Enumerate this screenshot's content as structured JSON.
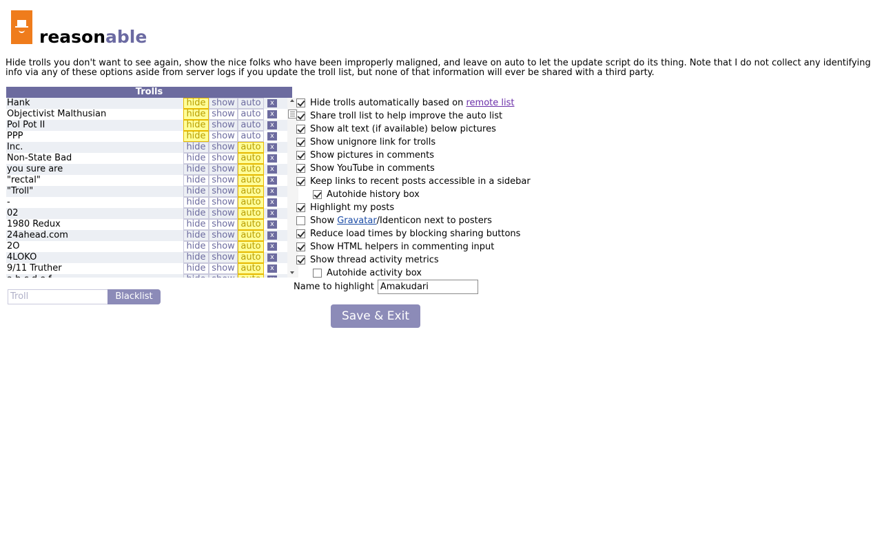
{
  "brand": {
    "text_a": "reason",
    "text_b": "able"
  },
  "intro": "Hide trolls you don't want to see again, show the nice folks who have been improperly maligned, and leave on auto to let the update script do its thing. Note that I do not collect any identifying info via any of these options aside from server logs if you update the troll list, but none of that information will ever be shared with a third party.",
  "trolls": {
    "header": "Trolls",
    "button_labels": {
      "hide": "hide",
      "show": "show",
      "auto": "auto",
      "remove": "x"
    },
    "rows": [
      {
        "name": "Hank",
        "state": "hide"
      },
      {
        "name": "Objectivist Malthusian",
        "state": "hide"
      },
      {
        "name": "Pol Pot II",
        "state": "hide"
      },
      {
        "name": "PPP",
        "state": "hide"
      },
      {
        "name": "Inc.",
        "state": "auto"
      },
      {
        "name": "Non-State Bad",
        "state": "auto"
      },
      {
        "name": "you sure are",
        "state": "auto"
      },
      {
        "name": "\"rectal\"",
        "state": "auto"
      },
      {
        "name": "\"Troll\"",
        "state": "auto"
      },
      {
        "name": "-",
        "state": "auto"
      },
      {
        "name": "02",
        "state": "auto"
      },
      {
        "name": "1980 Redux",
        "state": "auto"
      },
      {
        "name": "24ahead.com",
        "state": "auto"
      },
      {
        "name": "2O",
        "state": "auto"
      },
      {
        "name": "4LOKO",
        "state": "auto"
      },
      {
        "name": "9/11 Truther",
        "state": "auto"
      },
      {
        "name": "a b c d e f",
        "state": "auto"
      }
    ]
  },
  "blacklist": {
    "placeholder": "Troll",
    "button": "Blacklist"
  },
  "options": [
    {
      "label": "Hide trolls automatically based on ",
      "link": "remote list",
      "link_class": "purple",
      "checked": true,
      "sub": false
    },
    {
      "label": "Share troll list to help improve the auto list",
      "checked": true,
      "sub": false
    },
    {
      "label": "Show alt text (if available) below pictures",
      "checked": true,
      "sub": false
    },
    {
      "label": "Show unignore link for trolls",
      "checked": true,
      "sub": false
    },
    {
      "label": "Show pictures in comments",
      "checked": true,
      "sub": false
    },
    {
      "label": "Show YouTube in comments",
      "checked": true,
      "sub": false
    },
    {
      "label": "Keep links to recent posts accessible in a sidebar",
      "checked": true,
      "sub": false
    },
    {
      "label": "Autohide history box",
      "checked": true,
      "sub": true
    },
    {
      "label": "Highlight my posts",
      "checked": true,
      "sub": false
    },
    {
      "label": "Show ",
      "link": "Gravatar",
      "link_class": "blue",
      "suffix": "/Identicon next to posters",
      "checked": false,
      "sub": false
    },
    {
      "label": "Reduce load times by blocking sharing buttons",
      "checked": true,
      "sub": false
    },
    {
      "label": "Show HTML helpers in commenting input",
      "checked": true,
      "sub": false
    },
    {
      "label": "Show thread activity metrics",
      "checked": true,
      "sub": false
    },
    {
      "label": "Autohide activity box",
      "checked": false,
      "sub": true
    }
  ],
  "highlight": {
    "label": "Name to highlight",
    "value": "Amakudari"
  },
  "save_button": "Save & Exit"
}
